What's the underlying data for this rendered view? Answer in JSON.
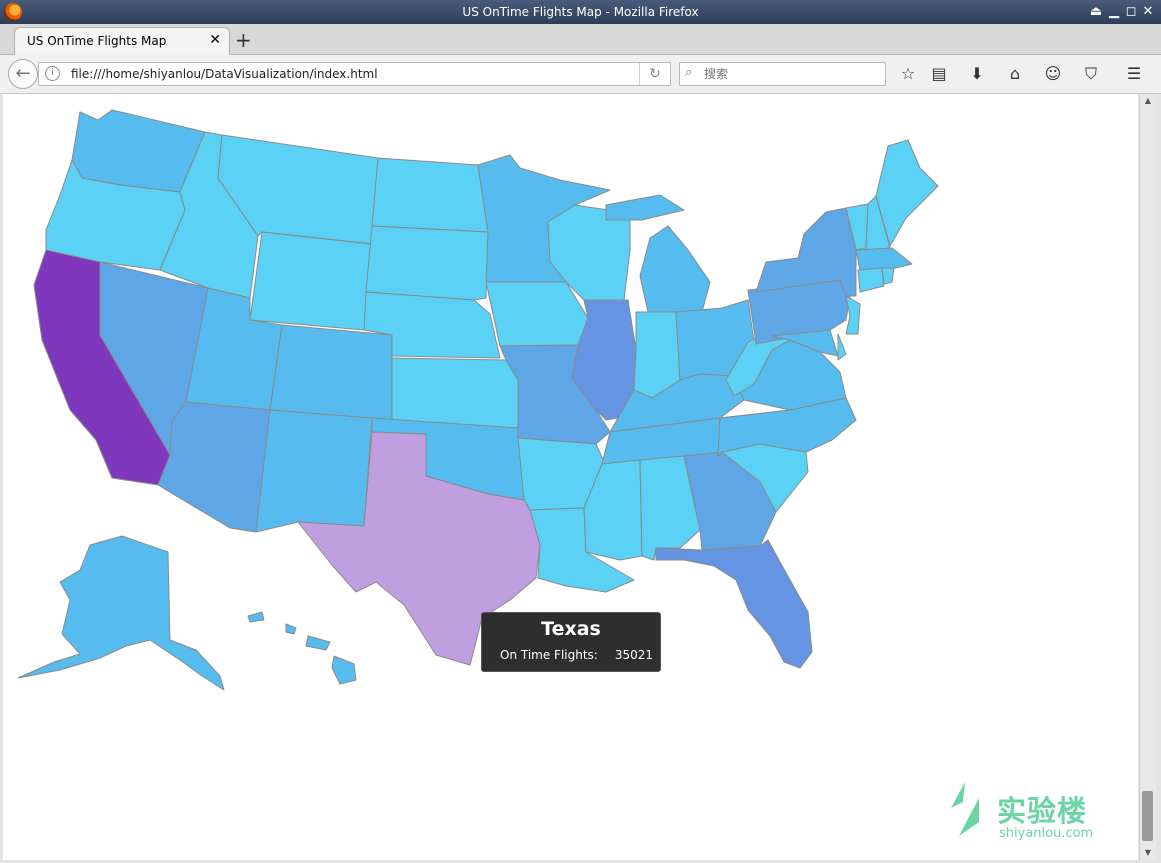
{
  "window": {
    "title": "US OnTime Flights Map - Mozilla Firefox"
  },
  "tab": {
    "label": "US OnTime Flights Map"
  },
  "toolbar": {
    "url": "file:///home/shiyanlou/DataVisualization/index.html",
    "search_placeholder": "搜索"
  },
  "tooltip": {
    "state": "Texas",
    "label": "On Time Flights:",
    "value": "35021"
  },
  "watermark": {
    "cn": "实验楼",
    "en": "shiyanlou.com"
  },
  "colors": {
    "lowest": "#5ad1f5",
    "low": "#56bcef",
    "mid": "#5ea6e6",
    "high": "#6595e2",
    "highlight": "#bf9fe0",
    "max": "#7e37bd",
    "border": "#8a8a8a"
  }
}
